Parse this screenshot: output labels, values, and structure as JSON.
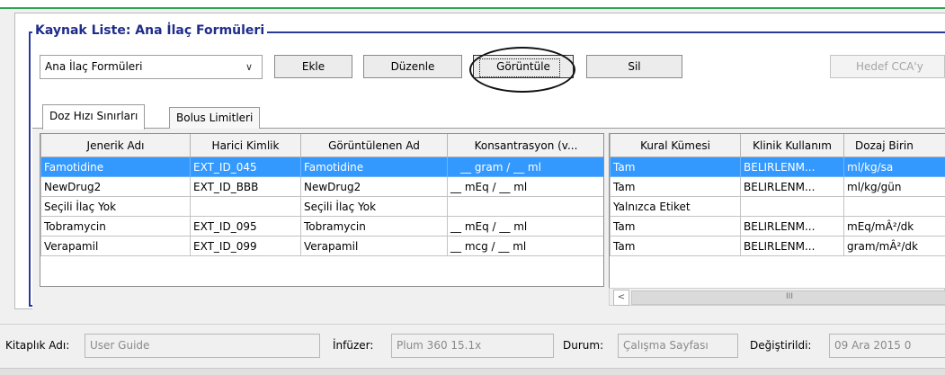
{
  "window": {
    "group_title": "Kaynak Liste: Ana İlaç Formüleri"
  },
  "toolbar": {
    "list_select": "Ana İlaç Formüleri",
    "add_label": "Ekle",
    "edit_label": "Düzenle",
    "view_label": "Görüntüle",
    "delete_label": "Sil",
    "target_label": "Hedef CCA'y"
  },
  "tabs": [
    {
      "label": "Doz Hızı Sınırları",
      "active": true
    },
    {
      "label": "Bolus Limitleri",
      "active": false
    }
  ],
  "left_table": {
    "headers": [
      "Jenerik Adı",
      "Harici Kimlik",
      "Görüntülenen Ad",
      "Konsantrasyon (v..."
    ],
    "rows": [
      [
        "Famotidine",
        "EXT_ID_045",
        "Famotidine",
        "__ gram / __ ml"
      ],
      [
        "NewDrug2",
        "EXT_ID_BBB",
        "NewDrug2",
        "__ mEq / __ ml"
      ],
      [
        "Seçili İlaç Yok",
        "",
        "Seçili İlaç Yok",
        ""
      ],
      [
        "Tobramycin",
        "EXT_ID_095",
        "Tobramycin",
        "__ mEq / __ ml"
      ],
      [
        "Verapamil",
        "EXT_ID_099",
        "Verapamil",
        "__ mcg / __ ml"
      ]
    ]
  },
  "right_table": {
    "headers": [
      "Kural Kümesi",
      "Klinik Kullanım",
      "Dozaj Birin"
    ],
    "rows": [
      [
        "Tam",
        "BELIRLENM...",
        "ml/kg/sa"
      ],
      [
        "Tam",
        "BELIRLENM...",
        "ml/kg/gün"
      ],
      [
        "Yalnızca Etiket",
        "",
        ""
      ],
      [
        "Tam",
        "BELIRLENM...",
        "mEq/mÂ²/dk"
      ],
      [
        "Tam",
        "BELIRLENM...",
        "gram/mÂ²/dk"
      ]
    ]
  },
  "selected_row": 0,
  "scrollbar": {
    "left_arrow": "<",
    "thumb_grip": "III"
  },
  "status": {
    "library_label": "Kitaplık Adı:",
    "library_value": "User Guide",
    "infuser_label": "İnfüzer:",
    "infuser_value": "Plum 360 15.1x",
    "state_label": "Durum:",
    "state_value": "Çalışma Sayfası",
    "modified_label": "Değiştirildi:",
    "modified_value": "09 Ara 2015 0"
  },
  "icons": {
    "dropdown": "chevron-down-icon"
  }
}
